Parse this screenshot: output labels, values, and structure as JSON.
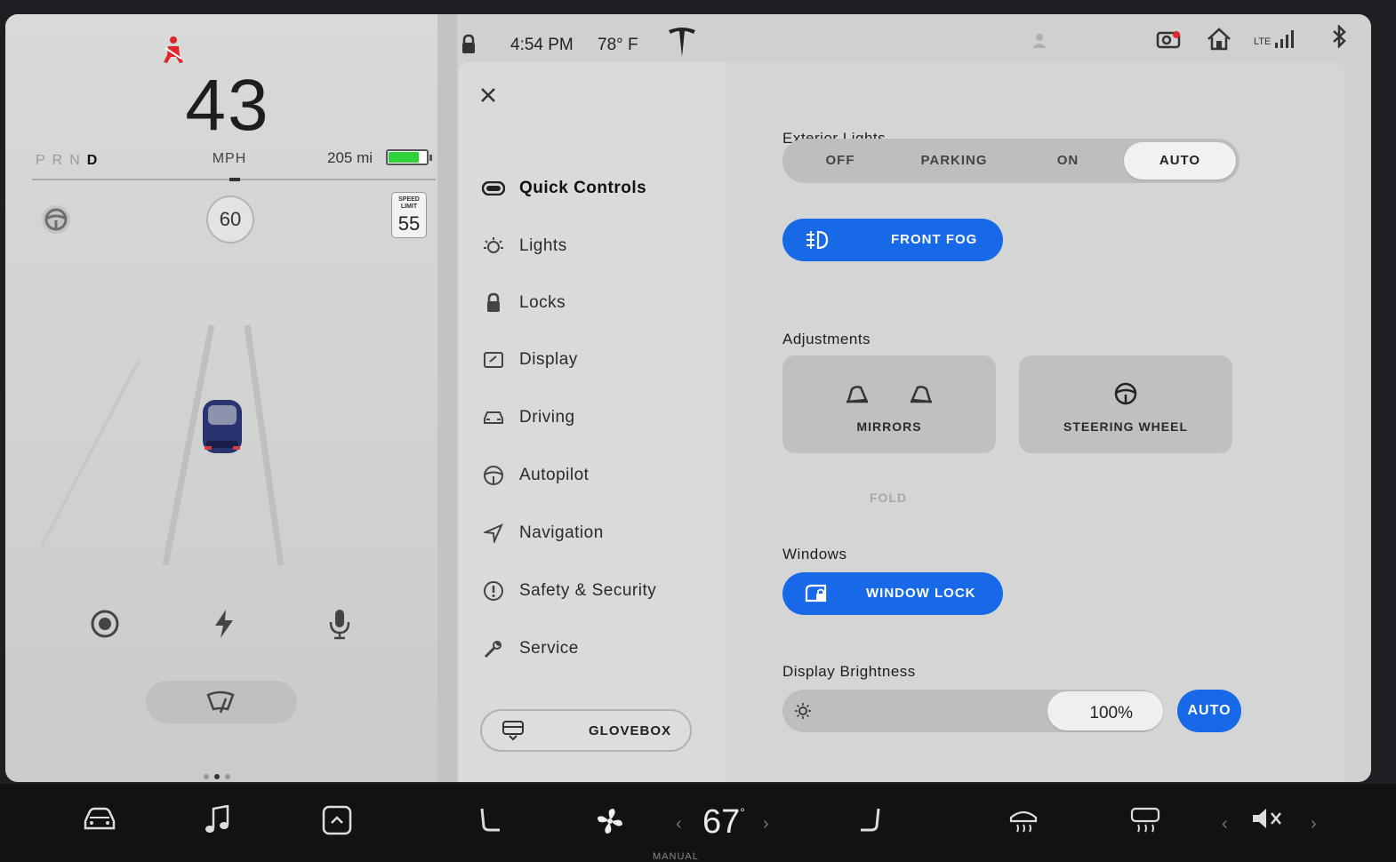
{
  "left_panel": {
    "speed": "43",
    "speed_unit": "MPH",
    "gears": [
      "P",
      "R",
      "N",
      "D"
    ],
    "active_gear": "D",
    "range": "205 mi",
    "battery_level": 0.82,
    "battery_color": "#2fd23a",
    "set_speed": "60",
    "speed_limit_label": "SPEED LIMIT",
    "speed_limit": "55"
  },
  "status_bar": {
    "time": "4:54 PM",
    "temperature": "78° F",
    "network": "LTE"
  },
  "settings": {
    "menu": [
      {
        "label": "Quick Controls",
        "icon": "toggle-icon",
        "active": true
      },
      {
        "label": "Lights",
        "icon": "bulb-icon"
      },
      {
        "label": "Locks",
        "icon": "lock-icon"
      },
      {
        "label": "Display",
        "icon": "display-icon"
      },
      {
        "label": "Driving",
        "icon": "car-icon"
      },
      {
        "label": "Autopilot",
        "icon": "steering-wheel-icon"
      },
      {
        "label": "Navigation",
        "icon": "navigation-icon"
      },
      {
        "label": "Safety & Security",
        "icon": "alert-icon"
      },
      {
        "label": "Service",
        "icon": "wrench-icon"
      }
    ],
    "glovebox_label": "GLOVEBOX",
    "exterior_lights": {
      "title": "Exterior Lights",
      "options": [
        "OFF",
        "PARKING",
        "ON",
        "AUTO"
      ],
      "selected": "AUTO"
    },
    "front_fog_label": "FRONT FOG",
    "adjustments": {
      "title": "Adjustments",
      "mirrors_label": "MIRRORS",
      "steering_label": "STEERING WHEEL",
      "fold_label": "FOLD"
    },
    "windows": {
      "title": "Windows",
      "window_lock_label": "WINDOW LOCK"
    },
    "brightness": {
      "title": "Display Brightness",
      "value": "100%",
      "level": 1.0,
      "auto_label": "AUTO"
    },
    "accent_color": "#1869e8"
  },
  "dock": {
    "temperature": "67",
    "degree_symbol": "°",
    "climate_mode": "MANUAL"
  }
}
